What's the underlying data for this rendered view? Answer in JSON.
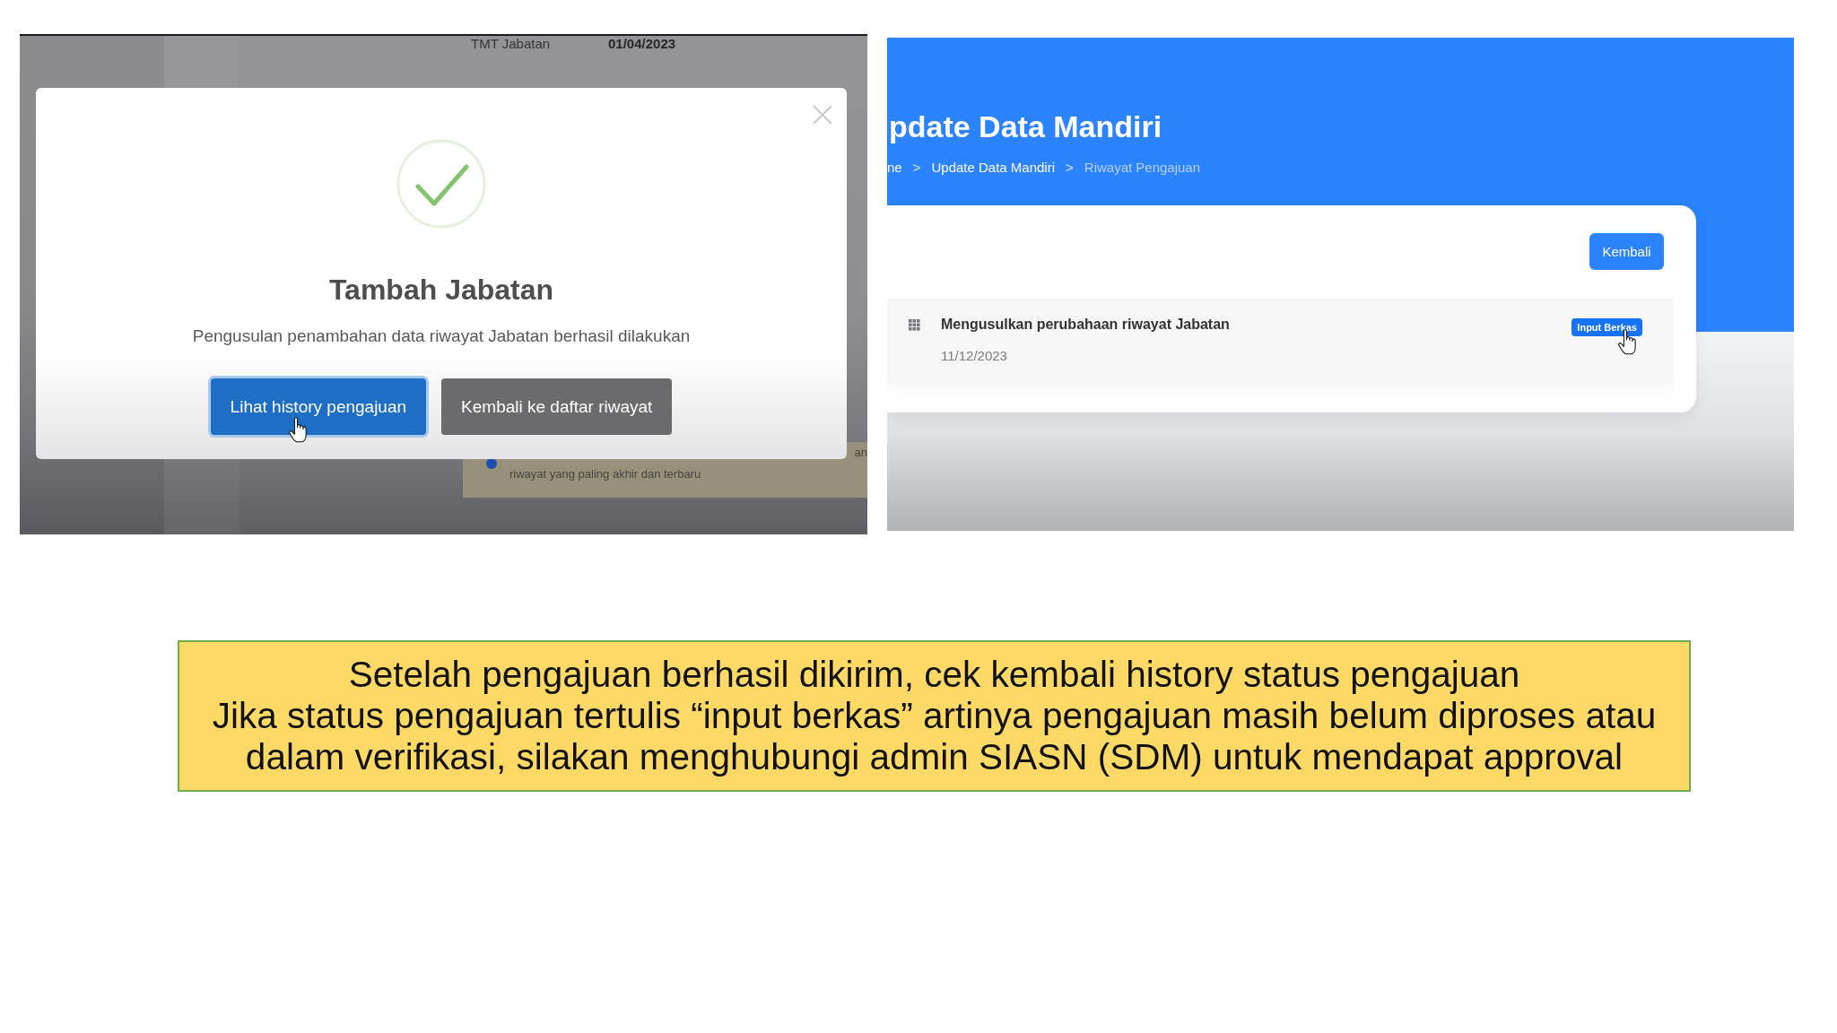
{
  "left_screenshot": {
    "background": {
      "fields": [
        {
          "label": "TMT Jabatan",
          "value": "01/04/2023"
        }
      ],
      "notice": {
        "text": "riwayat yang paling akhir dan terbaru",
        "edge_text": "an"
      }
    },
    "dialog": {
      "title": "Tambah Jabatan",
      "message": "Pengusulan penambahan data riwayat Jabatan berhasil dilakukan",
      "buttons": [
        {
          "label": "Lihat history pengajuan",
          "kind": "primary",
          "hovered": true
        },
        {
          "label": "Kembali ke daftar riwayat",
          "kind": "secondary",
          "hovered": false
        }
      ]
    }
  },
  "right_screenshot": {
    "header": {
      "title": "pdate Data Mandiri",
      "breadcrumb": [
        {
          "kind": "link",
          "text": "ne"
        },
        {
          "kind": "separator",
          "text": ">"
        },
        {
          "kind": "link",
          "text": "Update Data Mandiri"
        },
        {
          "kind": "separator",
          "text": ">"
        },
        {
          "kind": "current",
          "text": "Riwayat Pengajuan"
        }
      ]
    },
    "card": {
      "back_button": "Kembali",
      "submissions": [
        {
          "title": "Mengusulkan perubahaan riwayat Jabatan",
          "date": "11/12/2023",
          "status": "Input Berkas",
          "hovered": true
        }
      ]
    }
  },
  "caption": {
    "paragraphs": [
      "Setelah pengajuan berhasil dikirim, cek kembali history status pengajuan",
      "Jika status pengajuan tertulis “input berkas” artinya pengajuan masih belum diproses atau dalam verifikasi, silakan menghubungi admin SIASN (SDM) untuk mendapat approval"
    ]
  }
}
